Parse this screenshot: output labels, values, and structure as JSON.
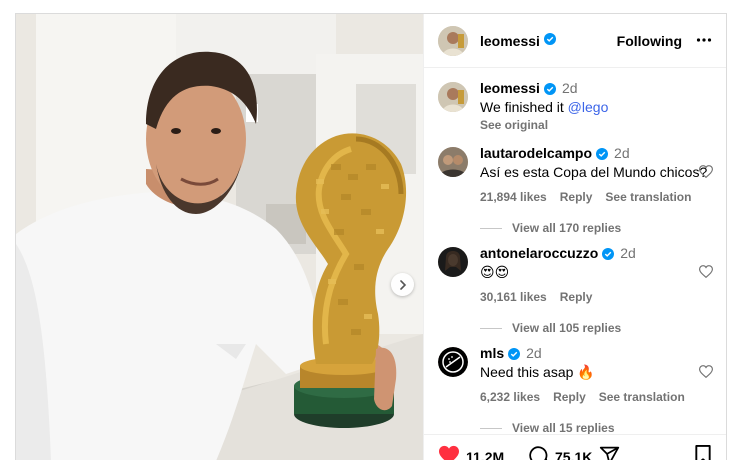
{
  "header": {
    "username": "leomessi",
    "follow_label": "Following"
  },
  "caption": {
    "username": "leomessi",
    "time": "2d",
    "text": "We finished it ",
    "mention": "@lego",
    "see_original": "See original"
  },
  "comments": [
    {
      "username": "lautarodelcampo",
      "time": "2d",
      "text": "Así es esta Copa del Mundo chicos?",
      "likes": "21,894 likes",
      "reply": "Reply",
      "translate": "See translation",
      "view_replies": "View all 170 replies"
    },
    {
      "username": "antonelaroccuzzo",
      "time": "2d",
      "text": "😍😍",
      "likes": "30,161 likes",
      "reply": "Reply",
      "view_replies": "View all 105 replies"
    },
    {
      "username": "mls",
      "time": "2d",
      "text": "Need this asap 🔥",
      "likes": "6,232 likes",
      "reply": "Reply",
      "translate": "See translation",
      "view_replies": "View all 15 replies"
    }
  ],
  "actions": {
    "like_count": "11.2M",
    "comment_count": "75.1K"
  },
  "colors": {
    "verified": "#0095f6",
    "mention": "#3b64e8",
    "like_red": "#ff3040",
    "secondary_text": "#737373"
  },
  "icons": [
    "verified-badge-icon",
    "more-options-icon",
    "heart-icon",
    "comment-icon",
    "share-icon",
    "bookmark-icon",
    "chevron-right-icon"
  ]
}
